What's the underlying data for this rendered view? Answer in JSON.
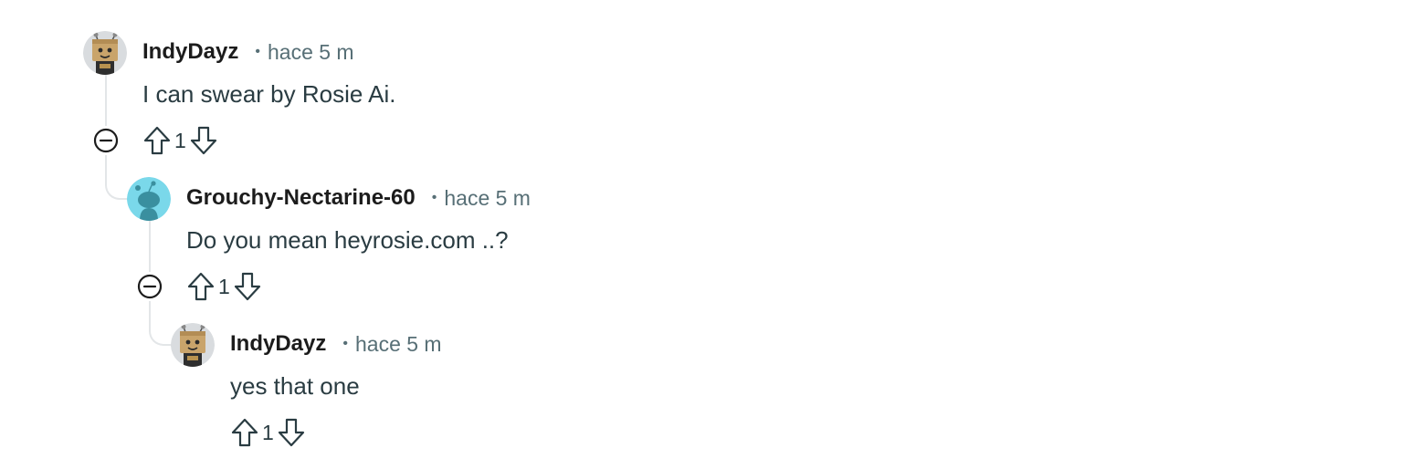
{
  "colors": {
    "thread_line": "#e3e6e8",
    "meta_text": "#576f76",
    "body_text": "#2a3c42",
    "snoo_bg": "#7ad8ea",
    "snoo_body": "#3a8f9f"
  },
  "icons": {
    "collapse": "minus-circle-icon",
    "upvote": "arrow-up-outline-icon",
    "downvote": "arrow-down-outline-icon",
    "robot_avatar": "cardboard-robot-avatar",
    "snoo_avatar": "default-snoo-avatar"
  },
  "comments": [
    {
      "author": "IndyDayz",
      "separator": "•",
      "time": "hace 5 m",
      "body": "I can swear by Rosie Ai.",
      "score": "1"
    },
    {
      "author": "Grouchy-Nectarine-60",
      "separator": "•",
      "time": "hace 5 m",
      "body": "Do you mean heyrosie.com ..?",
      "score": "1"
    },
    {
      "author": "IndyDayz",
      "separator": "•",
      "time": "hace 5 m",
      "body": "yes that one",
      "score": "1"
    }
  ]
}
